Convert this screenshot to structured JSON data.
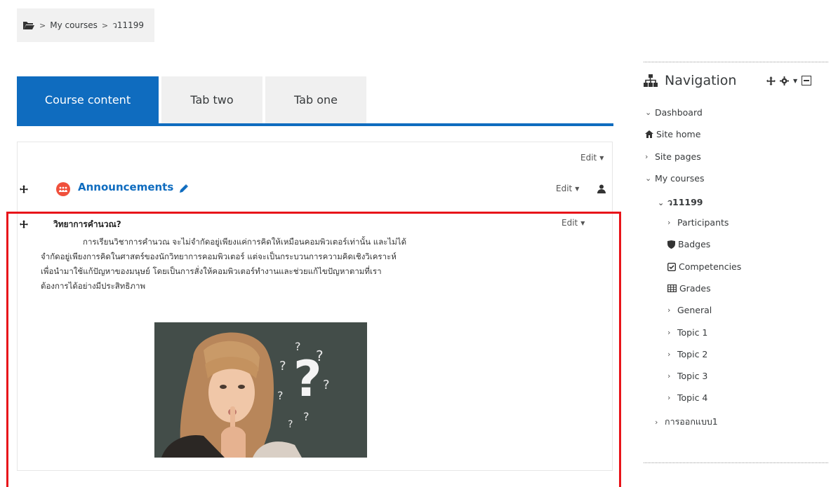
{
  "breadcrumb": {
    "items": [
      "My courses",
      "ว11199"
    ],
    "separator": ">"
  },
  "tabs": [
    {
      "label": "Course content",
      "active": true
    },
    {
      "label": "Tab two",
      "active": false
    },
    {
      "label": "Tab one",
      "active": false
    }
  ],
  "content": {
    "top_edit_label": "Edit",
    "announcements": {
      "title": "Announcements",
      "edit_label": "Edit"
    },
    "section": {
      "title": "วิทยาการคำนวณ?",
      "edit_label": "Edit",
      "paragraph_lines": [
        "การเรียนวิชาการคำนวณ จะไม่จำกัดอยู่เพียงแค่การคิดให้เหมือนคอมพิวเตอร์เท่านั้น และไม่ได้",
        "จำกัดอยู่เพียงการคิดในศาสตร์ของนักวิทยาการคอมพิวเตอร์ แต่จะเป็นกระบวนการความคิดเชิงวิเคราะห์",
        "เพื่อนำมาใช้แก้ปัญหาของมนุษย์ โดยเป็นการสั่งให้คอมพิวเตอร์ทำงานและช่วยแก้ไขปัญหาตามที่เรา",
        "ต้องการได้อย่างมีประสิทธิภาพ"
      ]
    }
  },
  "navigation": {
    "title": "Navigation",
    "items": [
      {
        "label": "Dashboard",
        "chevron": "down"
      },
      {
        "label": "Site home",
        "icon": "home-icon"
      },
      {
        "label": "Site pages",
        "chevron": "right"
      },
      {
        "label": "My courses",
        "chevron": "down"
      },
      {
        "label": "ว11199",
        "chevron": "down",
        "bold": true
      },
      {
        "label": "Participants",
        "chevron": "right"
      },
      {
        "label": "Badges",
        "icon": "shield-icon"
      },
      {
        "label": "Competencies",
        "icon": "checkbox-icon"
      },
      {
        "label": "Grades",
        "icon": "table-icon"
      },
      {
        "label": "General",
        "chevron": "right"
      },
      {
        "label": "Topic 1",
        "chevron": "right"
      },
      {
        "label": "Topic 2",
        "chevron": "right"
      },
      {
        "label": "Topic 3",
        "chevron": "right"
      },
      {
        "label": "Topic 4",
        "chevron": "right"
      },
      {
        "label": "การออกแบบ1",
        "chevron": "right"
      }
    ]
  },
  "colors": {
    "accent": "#0f6cbf",
    "highlight": "#e8141a",
    "announcement_icon": "#f0503c"
  }
}
